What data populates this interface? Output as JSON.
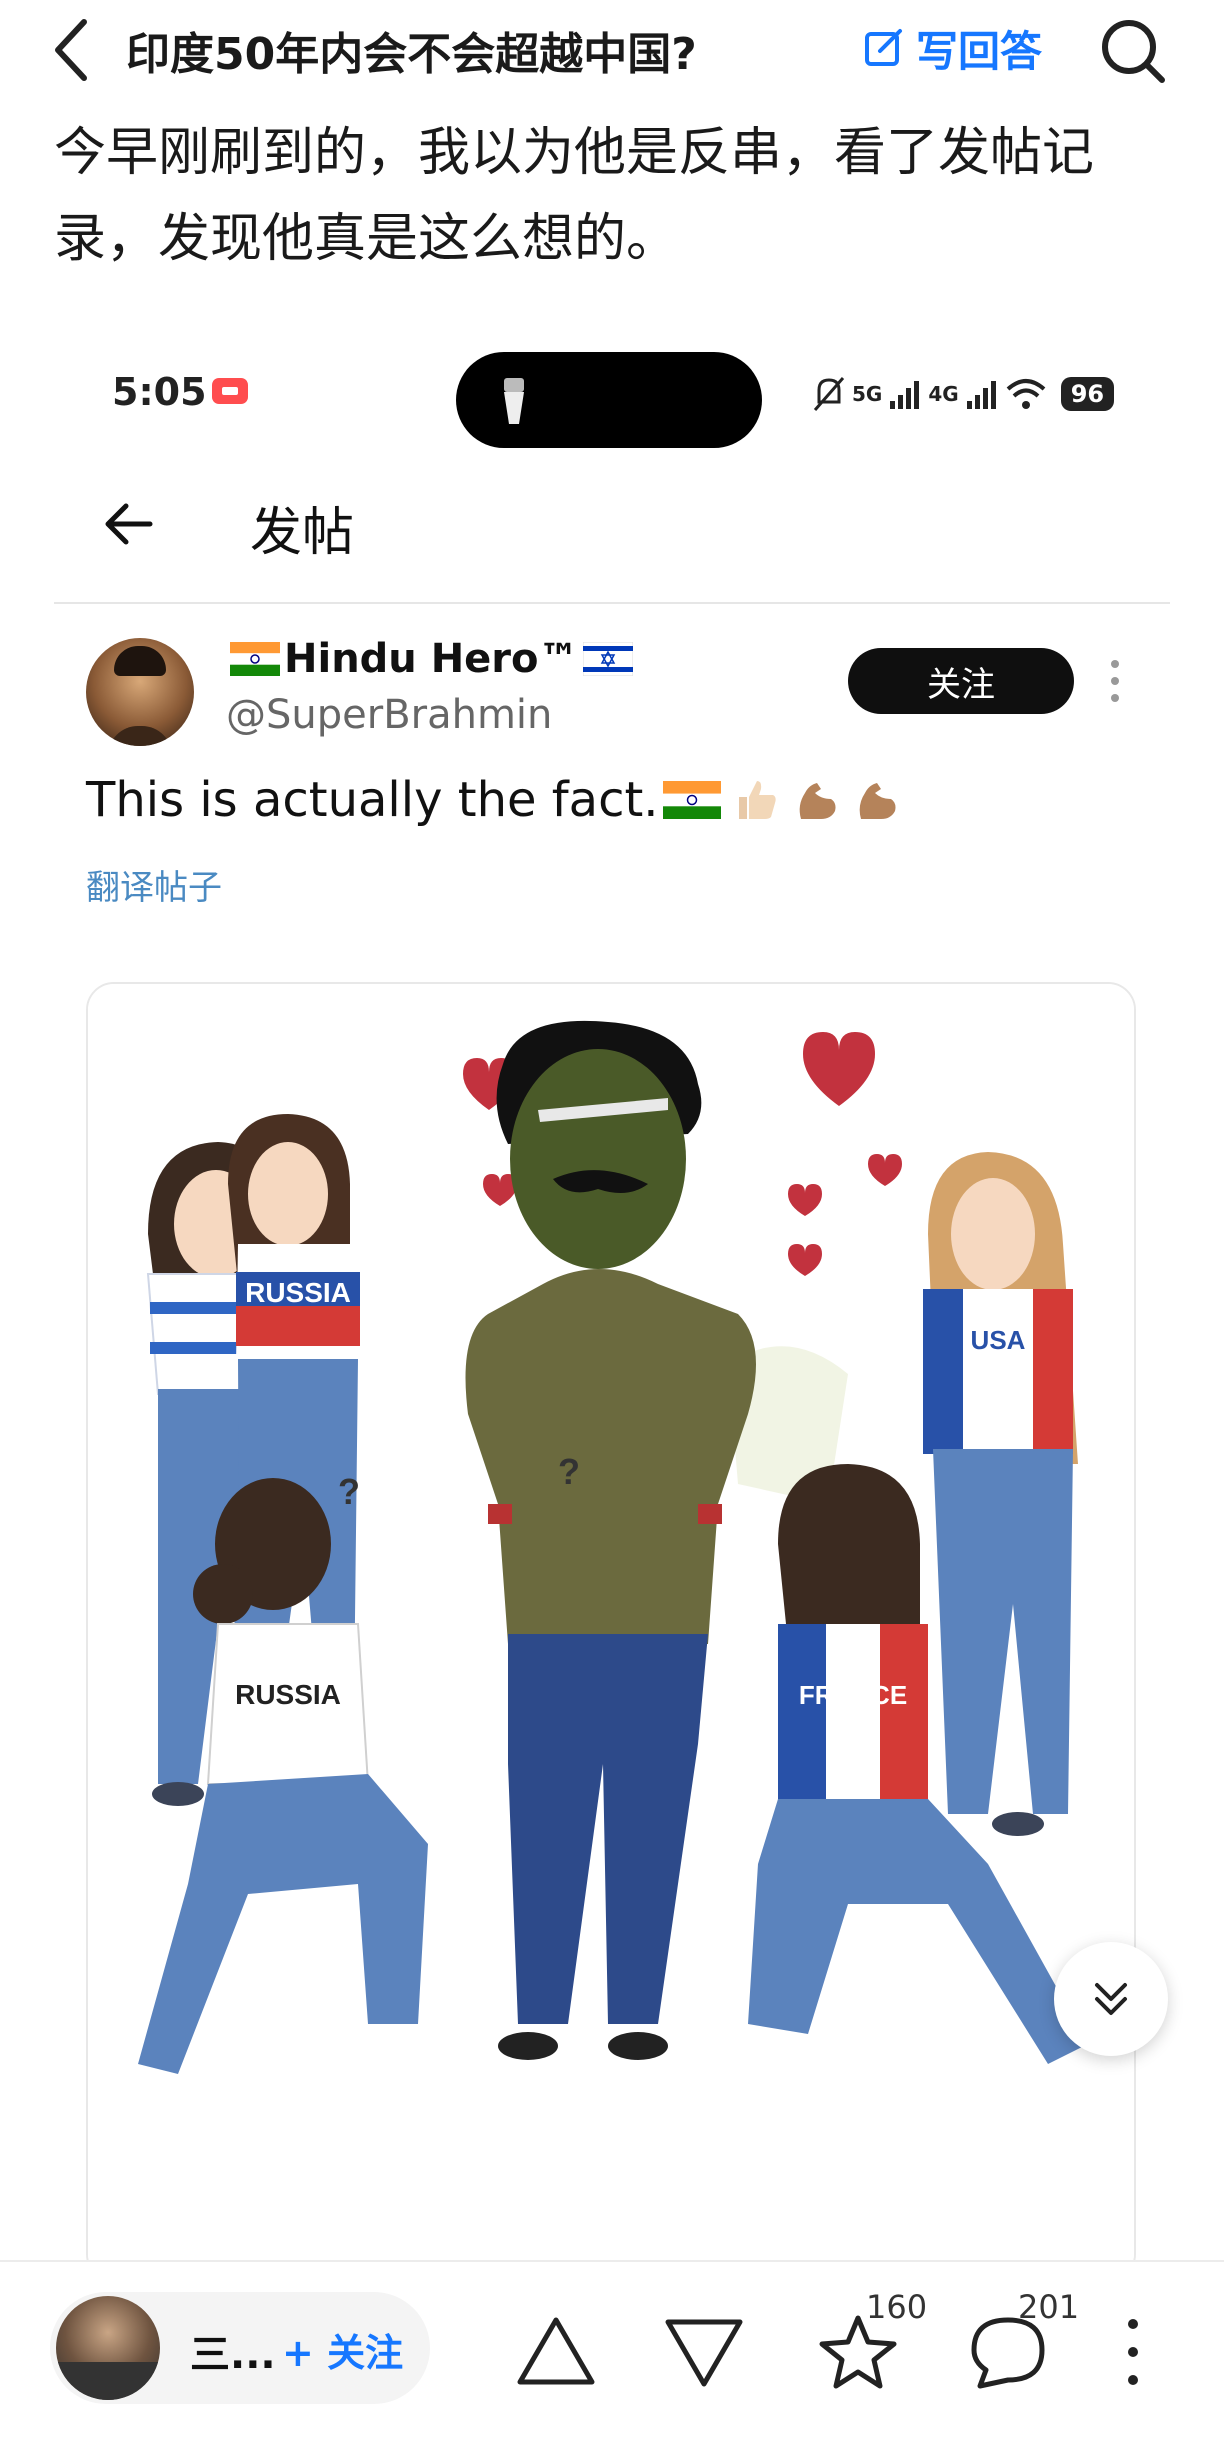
{
  "topbar": {
    "title": "印度50年内会不会超越中国?",
    "write_label": "写回答"
  },
  "question_text": "今早刚刷到的，我以为他是反串，看了发帖记录，发现他真是这么想的。",
  "screenshot": {
    "status": {
      "time": "5:05",
      "battery": "96",
      "net1": "5G",
      "net2": "4G"
    },
    "header_title": "发帖",
    "post": {
      "display_name": "Hindu Hero™",
      "handle": "@SuperBrahmin",
      "follow_label": "关注",
      "text": "This is actually the fact.",
      "translate_label": "翻译帖子",
      "image_labels": {
        "shirt1": "RUSSIA",
        "shirt2": "USA",
        "shirt3": "RUSSIA",
        "shirt4": "FRANCE"
      }
    }
  },
  "bottom": {
    "author_short": "三...",
    "follow_label": "+ 关注",
    "star_count": "160",
    "comment_count": "201"
  },
  "colors": {
    "accent": "#1677ff",
    "link": "#4a8ac2",
    "pill": "#0f0f0f"
  }
}
